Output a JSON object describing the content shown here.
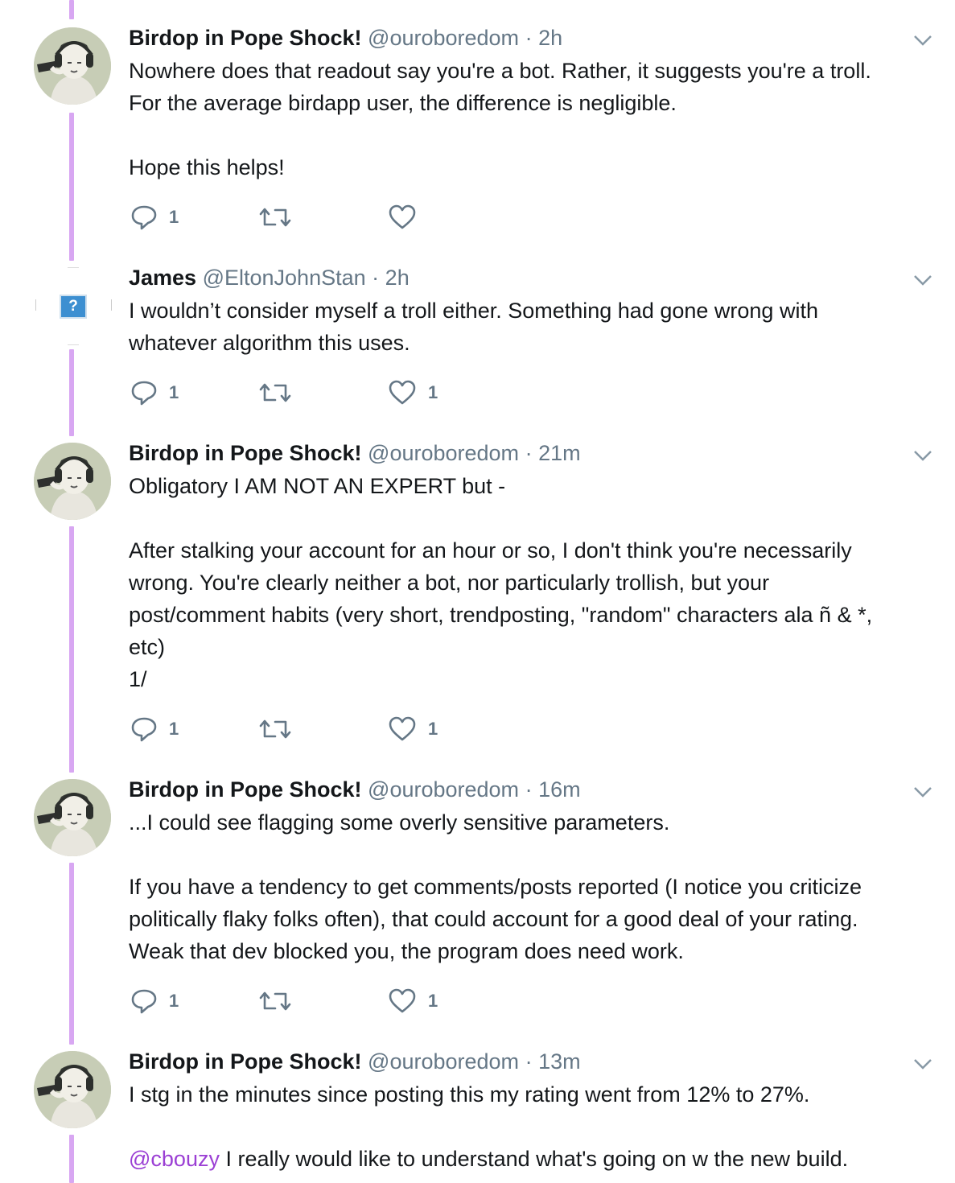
{
  "tweets": [
    {
      "name": "Birdop in Pope Shock!",
      "handle": "@ouroboredom",
      "separator": "·",
      "time": "2h",
      "avatar": "anime-avatar-headphones",
      "lines": [
        "Nowhere does that readout say you're a bot. Rather, it suggests you're a troll.",
        "For the average birdapp user, the difference is negligible.",
        "",
        "Hope this helps!"
      ],
      "reply_count": "1",
      "retweet_count": "",
      "like_count": ""
    },
    {
      "name": "James",
      "handle": "@EltonJohnStan",
      "separator": "·",
      "time": "2h",
      "avatar": "missing-image-placeholder",
      "avatar_placeholder": "?",
      "lines": [
        "I wouldn’t consider myself a troll either. Something had gone wrong with",
        "whatever algorithm this uses."
      ],
      "reply_count": "1",
      "retweet_count": "",
      "like_count": "1"
    },
    {
      "name": "Birdop in Pope Shock!",
      "handle": "@ouroboredom",
      "separator": "·",
      "time": "21m",
      "avatar": "anime-avatar-headphones",
      "lines": [
        "Obligatory I AM NOT AN EXPERT but -",
        "",
        "After stalking your account for an hour or so, I don't think you're necessarily",
        "wrong. You're clearly neither a bot, nor particularly trollish, but your",
        "post/comment habits (very short, trendposting, \"random\" characters ala ñ & *,",
        "etc)",
        "1/"
      ],
      "reply_count": "1",
      "retweet_count": "",
      "like_count": "1"
    },
    {
      "name": "Birdop in Pope Shock!",
      "handle": "@ouroboredom",
      "separator": "·",
      "time": "16m",
      "avatar": "anime-avatar-headphones",
      "lines": [
        "...I could see flagging some overly sensitive parameters.",
        "",
        "If you have a tendency to get comments/posts reported (I notice you criticize",
        "politically flaky folks often), that could account for a good deal of your rating.",
        "Weak that dev blocked you, the program does need work."
      ],
      "reply_count": "1",
      "retweet_count": "",
      "like_count": "1"
    },
    {
      "name": "Birdop in Pope Shock!",
      "handle": "@ouroboredom",
      "separator": "·",
      "time": "13m",
      "avatar": "anime-avatar-headphones",
      "line_1": "I stg in the minutes since posting this my rating went from 12% to 27%.",
      "mention": "@cbouzy",
      "line_2": " I really would like to understand what's going on w the new build."
    }
  ],
  "icons": {
    "reply": "reply-icon",
    "retweet": "retweet-icon",
    "like": "heart-icon",
    "menu": "chevron-down-icon"
  },
  "colors": {
    "thread_line": "#d8a7f2",
    "secondary_text": "#657786",
    "mention": "#9b3fd4"
  }
}
